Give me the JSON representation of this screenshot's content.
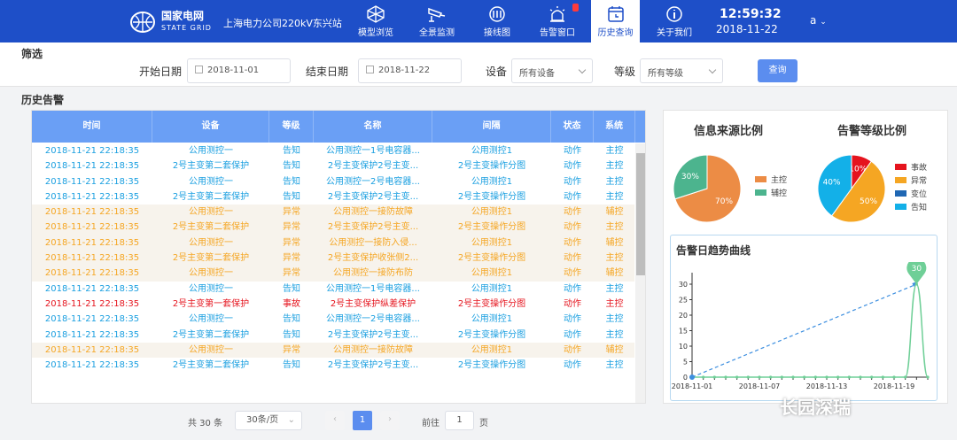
{
  "header": {
    "logo_cn": "国家电网",
    "logo_en": "STATE GRID",
    "station": "上海电力公司220kV东兴站",
    "nav": [
      {
        "label": "模型浏览",
        "icon": "model-icon"
      },
      {
        "label": "全景监测",
        "icon": "camera-icon"
      },
      {
        "label": "接线图",
        "icon": "wiring-icon"
      },
      {
        "label": "告警窗口",
        "icon": "alarm-icon"
      },
      {
        "label": "历史查询",
        "icon": "history-icon",
        "active": true
      },
      {
        "label": "关于我们",
        "icon": "info-icon"
      }
    ],
    "time": "12:59:32",
    "date": "2018-11-22",
    "user": "a"
  },
  "filter": {
    "title": "筛选",
    "start_label": "开始日期",
    "start_value": "2018-11-01",
    "end_label": "结束日期",
    "end_value": "2018-11-22",
    "device_label": "设备",
    "device_value": "所有设备",
    "level_label": "等级",
    "level_value": "所有等级",
    "query": "查询"
  },
  "history": {
    "title": "历史告警",
    "columns": [
      "时间",
      "设备",
      "等级",
      "名称",
      "间隔",
      "状态",
      "系统"
    ],
    "rows": [
      [
        "2018-11-21 22:18:35",
        "公用测控一",
        "告知",
        "公用测控一1号电容器...",
        "公用测控1",
        "动作",
        "主控"
      ],
      [
        "2018-11-21 22:18:35",
        "2号主变第二套保护",
        "告知",
        "2号主变保护2号主变...",
        "2号主变操作分图",
        "动作",
        "主控"
      ],
      [
        "2018-11-21 22:18:35",
        "公用测控一",
        "告知",
        "公用测控一2号电容器...",
        "公用测控1",
        "动作",
        "主控"
      ],
      [
        "2018-11-21 22:18:35",
        "2号主变第二套保护",
        "告知",
        "2号主变保护2号主变...",
        "2号主变操作分图",
        "动作",
        "主控"
      ],
      [
        "2018-11-21 22:18:35",
        "公用测控一",
        "异常",
        "公用测控一接防故障",
        "公用测控1",
        "动作",
        "辅控"
      ],
      [
        "2018-11-21 22:18:35",
        "2号主变第二套保护",
        "异常",
        "2号主变保护2号主变...",
        "2号主变操作分图",
        "动作",
        "主控"
      ],
      [
        "2018-11-21 22:18:35",
        "公用测控一",
        "异常",
        "公用测控一接防入侵...",
        "公用测控1",
        "动作",
        "辅控"
      ],
      [
        "2018-11-21 22:18:35",
        "2号主变第二套保护",
        "异常",
        "2号主变保护收张侧2...",
        "2号主变操作分图",
        "动作",
        "主控"
      ],
      [
        "2018-11-21 22:18:35",
        "公用测控一",
        "异常",
        "公用测控一接防布防",
        "公用测控1",
        "动作",
        "辅控"
      ],
      [
        "2018-11-21 22:18:35",
        "公用测控一",
        "告知",
        "公用测控一1号电容器...",
        "公用测控1",
        "动作",
        "主控"
      ],
      [
        "2018-11-21 22:18:35",
        "2号主变第一套保护",
        "事故",
        "2号主变保护纵差保护",
        "2号主变操作分图",
        "动作",
        "主控"
      ],
      [
        "2018-11-21 22:18:35",
        "公用测控一",
        "告知",
        "公用测控一2号电容器...",
        "公用测控1",
        "动作",
        "主控"
      ],
      [
        "2018-11-21 22:18:35",
        "2号主变第二套保护",
        "告知",
        "2号主变保护2号主变...",
        "2号主变操作分图",
        "动作",
        "主控"
      ],
      [
        "2018-11-21 22:18:35",
        "公用测控一",
        "异常",
        "公用测控一接防故障",
        "公用测控1",
        "动作",
        "辅控"
      ],
      [
        "2018-11-21 22:18:35",
        "2号主变第二套保护",
        "告知",
        "2号主变保护2号主变...",
        "2号主变操作分图",
        "动作",
        "主控"
      ]
    ]
  },
  "level_colors": {
    "告知": "#1a9fe0",
    "异常": "#f5a623",
    "事故": "#e5141e"
  },
  "pager": {
    "total": "共 30 条",
    "per_page": "30条/页",
    "current": "1",
    "goto_label": "前往",
    "goto_value": "1",
    "page_suffix": "页"
  },
  "source_pie": {
    "title": "信息来源比例",
    "slices": [
      {
        "name": "主控",
        "value": 70,
        "label": "70%",
        "color": "#ec8c45"
      },
      {
        "name": "辅控",
        "value": 30,
        "label": "30%",
        "color": "#4cb48e"
      }
    ]
  },
  "level_pie": {
    "title": "告警等级比例",
    "slices": [
      {
        "name": "事故",
        "value": 10,
        "label": "10%",
        "color": "#e5141e"
      },
      {
        "name": "异常",
        "value": 50,
        "label": "50%",
        "color": "#f5a623"
      },
      {
        "name": "变位",
        "value": 0,
        "label": "0%",
        "color": "#1f67b3"
      },
      {
        "name": "告知",
        "value": 40,
        "label": "40%",
        "color": "#13b0e8"
      }
    ]
  },
  "chart_data": {
    "type": "line",
    "title": "告警日趋势曲线",
    "x": [
      "2018-11-01",
      "2018-11-02",
      "2018-11-03",
      "2018-11-04",
      "2018-11-05",
      "2018-11-06",
      "2018-11-07",
      "2018-11-08",
      "2018-11-09",
      "2018-11-10",
      "2018-11-11",
      "2018-11-12",
      "2018-11-13",
      "2018-11-14",
      "2018-11-15",
      "2018-11-16",
      "2018-11-17",
      "2018-11-18",
      "2018-11-19",
      "2018-11-20",
      "2018-11-21",
      "2018-11-22"
    ],
    "xtick_labels": [
      "2018-11-01",
      "2018-11-07",
      "2018-11-13",
      "2018-11-19"
    ],
    "series": [
      {
        "values": [
          0,
          0,
          0,
          0,
          0,
          0,
          0,
          0,
          0,
          0,
          0,
          0,
          0,
          0,
          0,
          0,
          0,
          0,
          0,
          0,
          30,
          0
        ],
        "color": "#6fcf97"
      }
    ],
    "yticks": [
      0,
      5,
      10,
      15,
      20,
      25,
      30
    ],
    "ylim": [
      0,
      32
    ],
    "peak_label": "30",
    "trend_line": {
      "from": [
        0,
        0
      ],
      "to": [
        20,
        30
      ],
      "color": "#3d8fe0"
    }
  },
  "watermark": "长园深瑞"
}
